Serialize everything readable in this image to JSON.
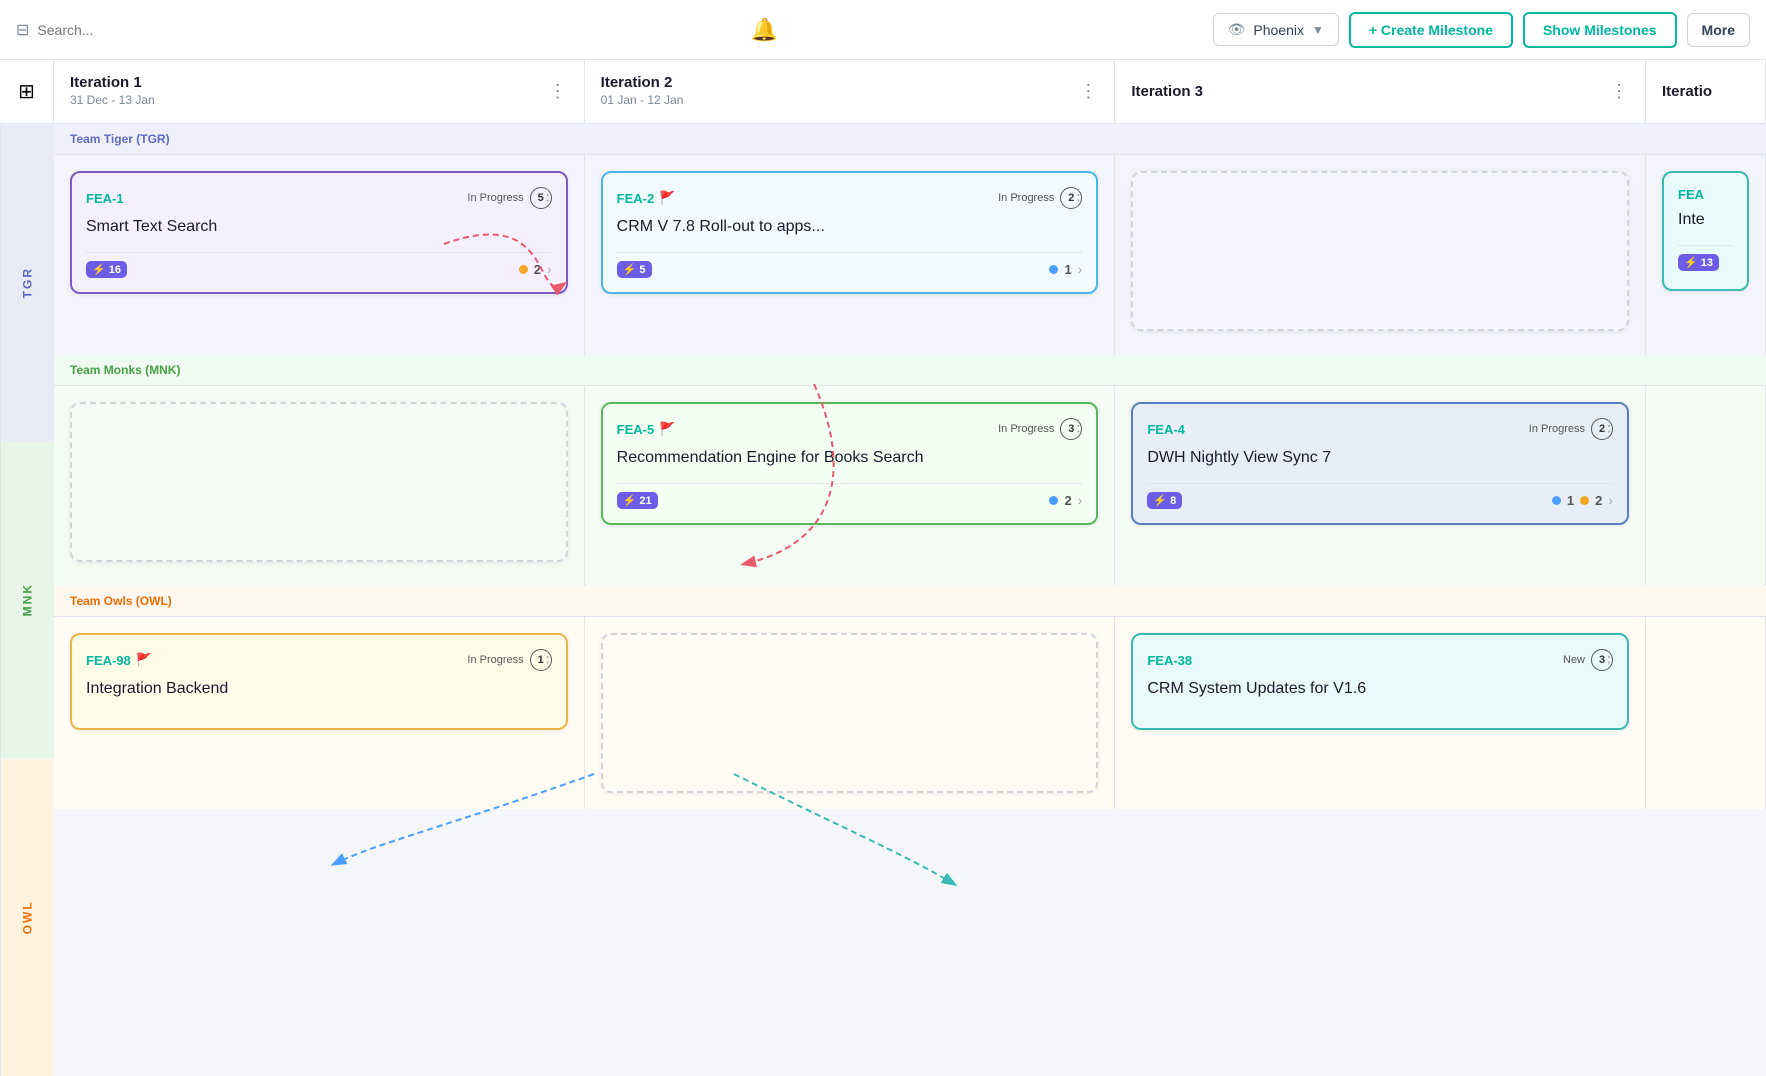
{
  "header": {
    "search_placeholder": "Search...",
    "bell": "🔔",
    "project_label": "Phoenix",
    "create_milestone": "+ Create Milestone",
    "show_milestones": "Show Milestones",
    "more": "More"
  },
  "iterations": [
    {
      "id": "iteration-1",
      "title": "Iteration 1",
      "dates": "31 Dec - 13 Jan"
    },
    {
      "id": "iteration-2",
      "title": "Iteration 2",
      "dates": "01 Jan - 12 Jan"
    },
    {
      "id": "iteration-3",
      "title": "Iteration 3",
      "dates": ""
    },
    {
      "id": "iteration-4",
      "title": "Iteratio",
      "dates": ""
    }
  ],
  "teams": [
    {
      "id": "tgr",
      "label": "TGR",
      "name": "Team Tiger (TGR)",
      "color_class": "team-tgr",
      "cells": [
        {
          "card": {
            "id": "FEA-1",
            "status": "In Progress",
            "badge": "5",
            "flag": true,
            "title": "Smart Text Search",
            "lightning": "16",
            "dot": "orange",
            "count": "2",
            "color": "purple"
          }
        },
        {
          "card": {
            "id": "FEA-2",
            "status": "In Progress",
            "badge": "2",
            "flag": true,
            "title": "CRM V 7.8 Roll-out to apps...",
            "lightning": "5",
            "dot": "blue",
            "count": "1",
            "color": "blue"
          }
        },
        {
          "card": null
        },
        {
          "card": {
            "id": "FEA",
            "status": "",
            "badge": "",
            "flag": false,
            "title": "Inte",
            "lightning": "13",
            "dot": null,
            "count": "",
            "color": "teal",
            "partial": true
          }
        }
      ]
    },
    {
      "id": "mnk",
      "label": "MNK",
      "name": "Team Monks (MNK)",
      "color_class": "team-mnk",
      "cells": [
        {
          "card": null
        },
        {
          "card": {
            "id": "FEA-5",
            "status": "In Progress",
            "badge": "3",
            "flag": true,
            "title": "Recommendation Engine for Books Search",
            "lightning": "21",
            "dot": "blue",
            "count": "2",
            "color": "green"
          }
        },
        {
          "card": {
            "id": "FEA-4",
            "status": "In Progress",
            "badge": "2",
            "flag": false,
            "title": "DWH Nightly View Sync 7",
            "lightning": "8",
            "dot_blue": "1",
            "dot_orange": "2",
            "color": "dark-blue"
          }
        },
        {
          "card": null
        }
      ]
    },
    {
      "id": "owl",
      "label": "OWL",
      "name": "Team Owls (OWL)",
      "color_class": "team-owl",
      "cells": [
        {
          "card": {
            "id": "FEA-98",
            "status": "In Progress",
            "badge": "1",
            "flag": true,
            "title": "Integration Backend",
            "lightning": "",
            "dot": null,
            "count": "",
            "color": "yellow",
            "partial_bottom": true
          }
        },
        {
          "card": null
        },
        {
          "card": {
            "id": "FEA-38",
            "status": "New",
            "badge": "3",
            "flag": false,
            "title": "CRM System Updates for V1.6",
            "lightning": "",
            "dot": null,
            "count": "",
            "color": "teal",
            "partial_bottom": true
          }
        },
        {
          "card": null
        }
      ]
    }
  ]
}
